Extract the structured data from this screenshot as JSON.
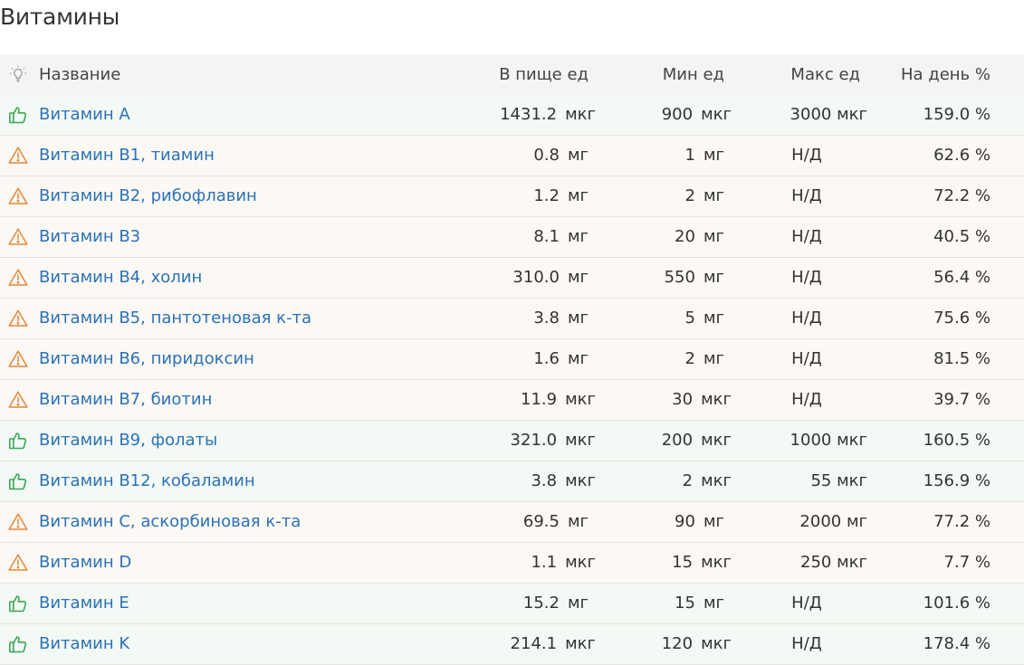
{
  "page_title": "Витамины",
  "header": {
    "icon": "lightbulb-icon",
    "name": "Название",
    "food": "В пище ед",
    "min": "Мин ед",
    "max": "Макс ед",
    "day": "На день %"
  },
  "colors": {
    "ok_icon": "#3aa657",
    "warn_icon": "#e2873b",
    "link": "#2a72b8",
    "ok_row": "#f3f9f4",
    "warn_row": "#fcf8f3"
  },
  "rows": [
    {
      "status": "ok",
      "icon": "thumbs-up-icon",
      "name": "Витамин A",
      "food_val": "1431.2",
      "food_unit": "мкг",
      "min_val": "900",
      "min_unit": "мкг",
      "max": "3000 мкг",
      "day": "159.0 %"
    },
    {
      "status": "warn",
      "icon": "warning-icon",
      "name": "Витамин B1, тиамин",
      "food_val": "0.8",
      "food_unit": "мг",
      "min_val": "1",
      "min_unit": "мг",
      "max": "Н/Д",
      "day": "62.6 %"
    },
    {
      "status": "warn",
      "icon": "warning-icon",
      "name": "Витамин B2, рибофлавин",
      "food_val": "1.2",
      "food_unit": "мг",
      "min_val": "2",
      "min_unit": "мг",
      "max": "Н/Д",
      "day": "72.2 %"
    },
    {
      "status": "warn",
      "icon": "warning-icon",
      "name": "Витамин B3",
      "food_val": "8.1",
      "food_unit": "мг",
      "min_val": "20",
      "min_unit": "мг",
      "max": "Н/Д",
      "day": "40.5 %"
    },
    {
      "status": "warn",
      "icon": "warning-icon",
      "name": "Витамин B4, холин",
      "food_val": "310.0",
      "food_unit": "мг",
      "min_val": "550",
      "min_unit": "мг",
      "max": "Н/Д",
      "day": "56.4 %"
    },
    {
      "status": "warn",
      "icon": "warning-icon",
      "name": "Витамин B5, пантотеновая к-та",
      "food_val": "3.8",
      "food_unit": "мг",
      "min_val": "5",
      "min_unit": "мг",
      "max": "Н/Д",
      "day": "75.6 %"
    },
    {
      "status": "warn",
      "icon": "warning-icon",
      "name": "Витамин B6, пиридоксин",
      "food_val": "1.6",
      "food_unit": "мг",
      "min_val": "2",
      "min_unit": "мг",
      "max": "Н/Д",
      "day": "81.5 %"
    },
    {
      "status": "warn",
      "icon": "warning-icon",
      "name": "Витамин B7, биотин",
      "food_val": "11.9",
      "food_unit": "мкг",
      "min_val": "30",
      "min_unit": "мкг",
      "max": "Н/Д",
      "day": "39.7 %"
    },
    {
      "status": "ok",
      "icon": "thumbs-up-icon",
      "name": "Витамин B9, фолаты",
      "food_val": "321.0",
      "food_unit": "мкг",
      "min_val": "200",
      "min_unit": "мкг",
      "max": "1000 мкг",
      "day": "160.5 %"
    },
    {
      "status": "ok",
      "icon": "thumbs-up-icon",
      "name": "Витамин B12, кобаламин",
      "food_val": "3.8",
      "food_unit": "мкг",
      "min_val": "2",
      "min_unit": "мкг",
      "max": "55 мкг",
      "day": "156.9 %"
    },
    {
      "status": "warn",
      "icon": "warning-icon",
      "name": "Витамин C, аскорбиновая к-та",
      "food_val": "69.5",
      "food_unit": "мг",
      "min_val": "90",
      "min_unit": "мг",
      "max": "2000 мг",
      "day": "77.2 %"
    },
    {
      "status": "warn",
      "icon": "warning-icon",
      "name": "Витамин D",
      "food_val": "1.1",
      "food_unit": "мкг",
      "min_val": "15",
      "min_unit": "мкг",
      "max": "250 мкг",
      "day": "7.7 %"
    },
    {
      "status": "ok",
      "icon": "thumbs-up-icon",
      "name": "Витамин E",
      "food_val": "15.2",
      "food_unit": "мг",
      "min_val": "15",
      "min_unit": "мг",
      "max": "Н/Д",
      "day": "101.6 %"
    },
    {
      "status": "ok",
      "icon": "thumbs-up-icon",
      "name": "Витамин K",
      "food_val": "214.1",
      "food_unit": "мкг",
      "min_val": "120",
      "min_unit": "мкг",
      "max": "Н/Д",
      "day": "178.4 %"
    }
  ]
}
